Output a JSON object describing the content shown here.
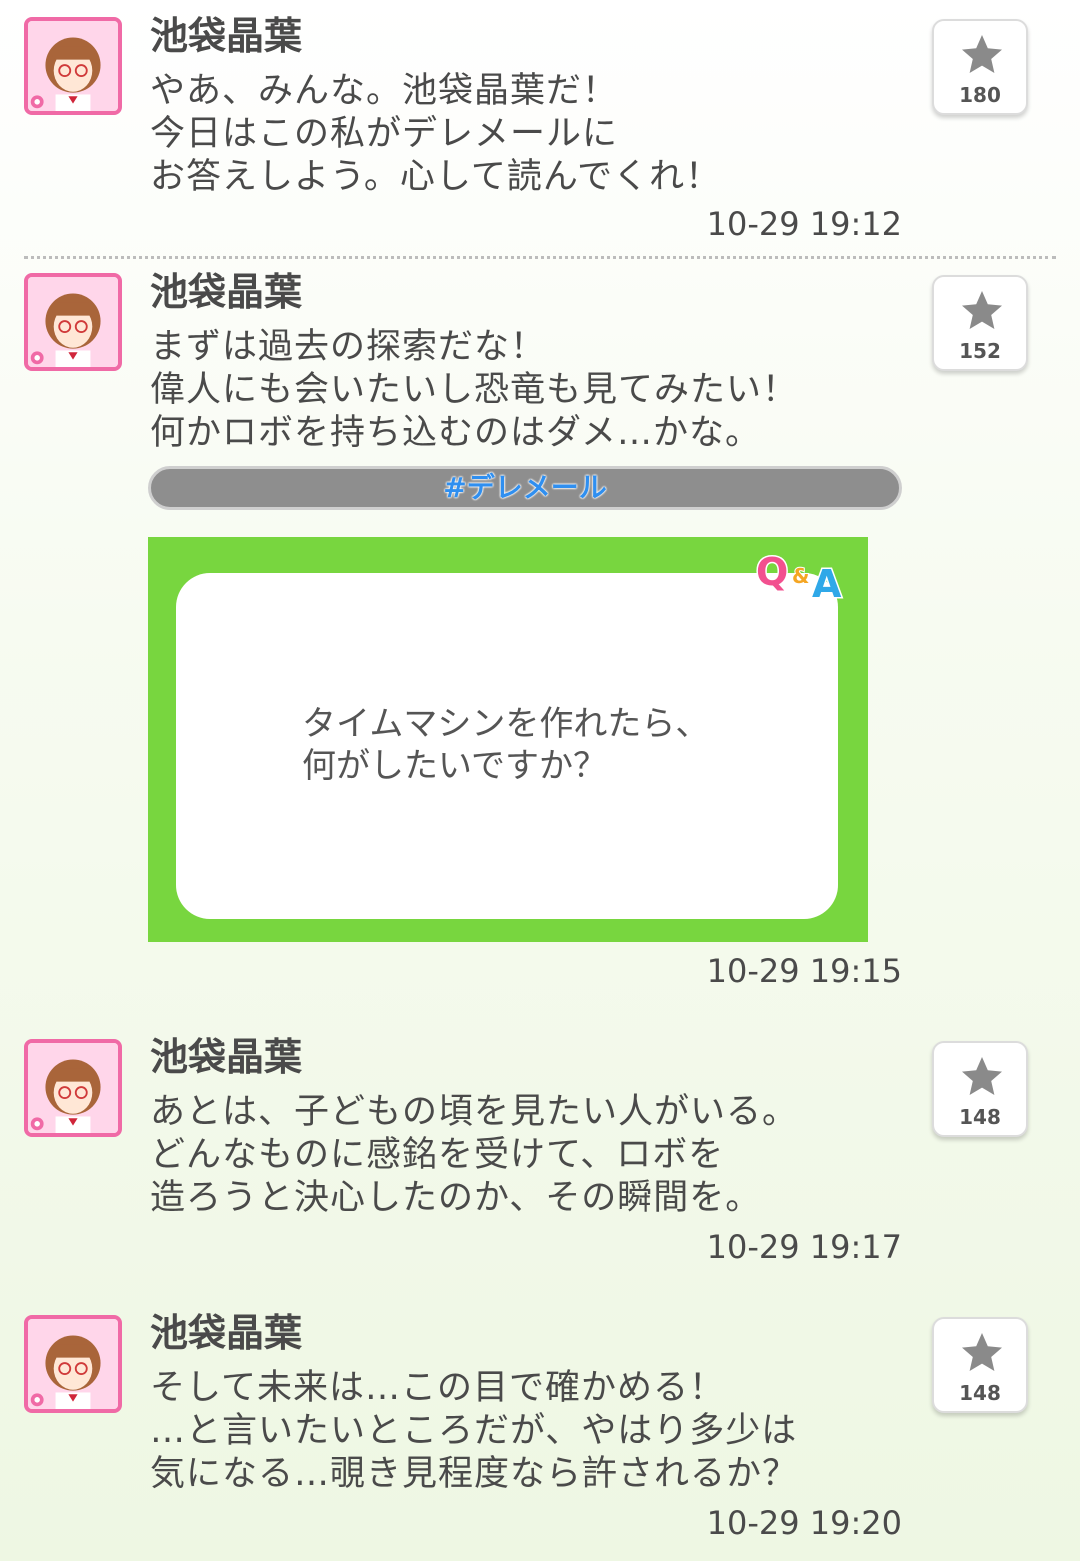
{
  "posts": [
    {
      "author": "池袋晶葉",
      "text": "やあ、みんな。池袋晶葉だ！\n今日はこの私がデレメールに\nお答えしよう。心して読んでくれ！",
      "time": "10-29 19:12",
      "likes": "180"
    },
    {
      "author": "池袋晶葉",
      "text": "まずは過去の探索だな！\n偉人にも会いたいし恐竜も見てみたい！\n何かロボを持ち込むのはダメ…かな。",
      "hashtag": "#デレメール",
      "qa_badge": "Q&A",
      "qa_question": "タイムマシンを作れたら、\n何がしたいですか？",
      "time": "10-29 19:15",
      "likes": "152"
    },
    {
      "author": "池袋晶葉",
      "text": "あとは、子どもの頃を見たい人がいる。\nどんなものに感銘を受けて、ロボを\n造ろうと決心したのか、その瞬間を。",
      "time": "10-29 19:17",
      "likes": "148"
    },
    {
      "author": "池袋晶葉",
      "text": "そして未来は…この目で確かめる！\n…と言いたいところだが、やはり多少は\n気になる…覗き見程度なら許されるか？",
      "time": "10-29 19:20",
      "likes": "148"
    }
  ],
  "colors": {
    "avatar_border": "#f06aa6",
    "qa_green": "#78d63f",
    "hashtag_blue": "#2f8ff0"
  },
  "icons": {
    "like": "star-icon",
    "avatar": "character-avatar",
    "avatar_badge": "flower-icon"
  }
}
